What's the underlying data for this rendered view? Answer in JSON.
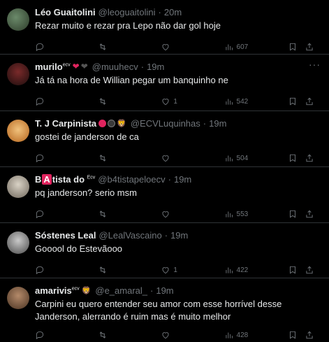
{
  "tweets": [
    {
      "name": "Léo Guaitolini",
      "handle": "@leoguaitolini",
      "time": "20m",
      "text": "Rezar muito e rezar pra Lepo não dar gol hoje",
      "replies": "",
      "retweets": "",
      "likes": "",
      "views": "607"
    },
    {
      "name": "murilo",
      "name_sup": "ecv",
      "handle": "@muuhecv",
      "time": "19m",
      "text": "Já tá na hora de Willian pegar um banquinho ne",
      "replies": "",
      "retweets": "",
      "likes": "1",
      "views": "542"
    },
    {
      "name": "T. J Carpinista",
      "handle": "@ECVLuquinhas",
      "time": "19m",
      "text": "gostei de janderson de ca",
      "replies": "",
      "retweets": "",
      "likes": "",
      "views": "504"
    },
    {
      "name_pre": "B",
      "name_box": "A",
      "name_post": "tista do",
      "name_sup": "Ecv",
      "handle": "@b4tistapeloecv",
      "time": "19m",
      "text": "pq janderson? serio msm",
      "replies": "",
      "retweets": "",
      "likes": "",
      "views": "553"
    },
    {
      "name": "Sóstenes Leal",
      "handle": "@LealVascaino",
      "time": "19m",
      "text": "Gooool do Estevãooo",
      "replies": "",
      "retweets": "",
      "likes": "1",
      "views": "422"
    },
    {
      "name": "amarivis",
      "name_sup": "ecv",
      "handle": "@e_amaral_",
      "time": "19m",
      "text": "Carpini eu quero entender seu amor com esse horrível desse Janderson, alerrando é ruim mas é muito melhor",
      "replies": "",
      "retweets": "",
      "likes": "",
      "views": "428"
    }
  ],
  "separator": "·",
  "more_glyph": "···",
  "colors": {
    "background": "#000000",
    "text": "#e7e9ea",
    "muted": "#71767b",
    "border": "#2f3336"
  }
}
